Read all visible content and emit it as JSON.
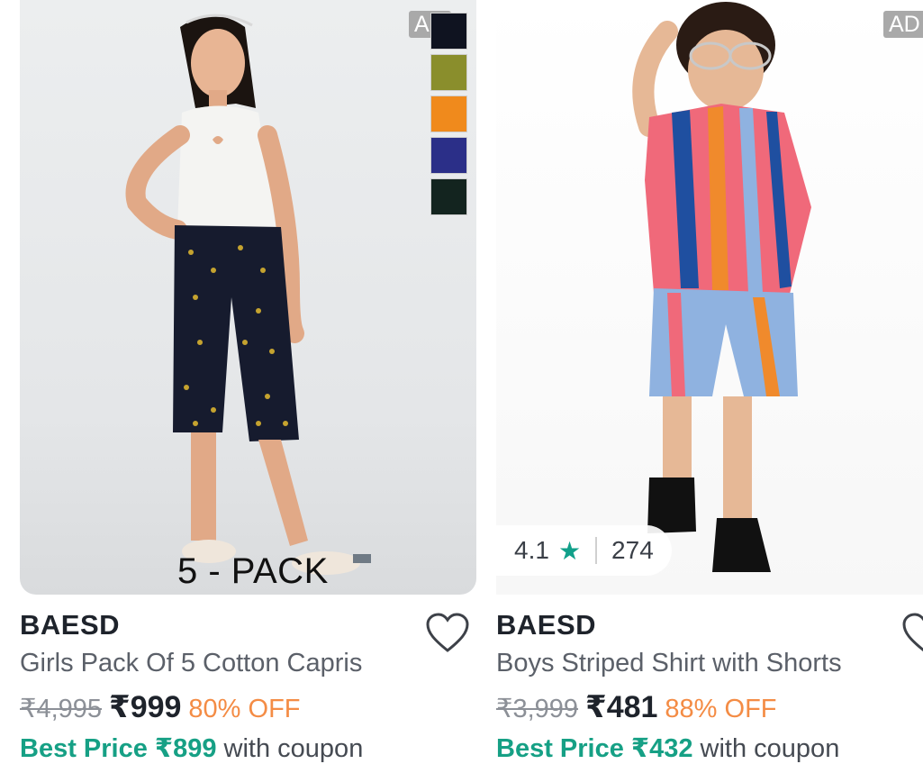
{
  "products": [
    {
      "ad_label": "AD",
      "overlay_text": "5 - PACK",
      "swatch_colors": [
        "#0f1320",
        "#8a8e2c",
        "#f08a1c",
        "#2b2f88",
        "#13241f"
      ],
      "brand": "BAESD",
      "title": "Girls Pack Of 5 Cotton Capris",
      "mrp": "₹4,995",
      "price": "₹999",
      "discount": "80% OFF",
      "best_price_label": "Best Price ₹899",
      "best_price_suffix": "with coupon",
      "wishlist_icon": "heart-outline-icon"
    },
    {
      "ad_label": "AD",
      "rating": "4.1",
      "rating_icon": "star-icon",
      "rating_count": "274",
      "brand": "BAESD",
      "title": "Boys Striped Shirt with Shorts",
      "mrp": "₹3,999",
      "price": "₹481",
      "discount": "88% OFF",
      "best_price_label": "Best Price ₹432",
      "best_price_suffix": "with coupon",
      "wishlist_icon": "heart-outline-icon"
    }
  ],
  "colors": {
    "best_price": "#16a085",
    "discount": "#f48c45",
    "star": "#11a08a"
  }
}
